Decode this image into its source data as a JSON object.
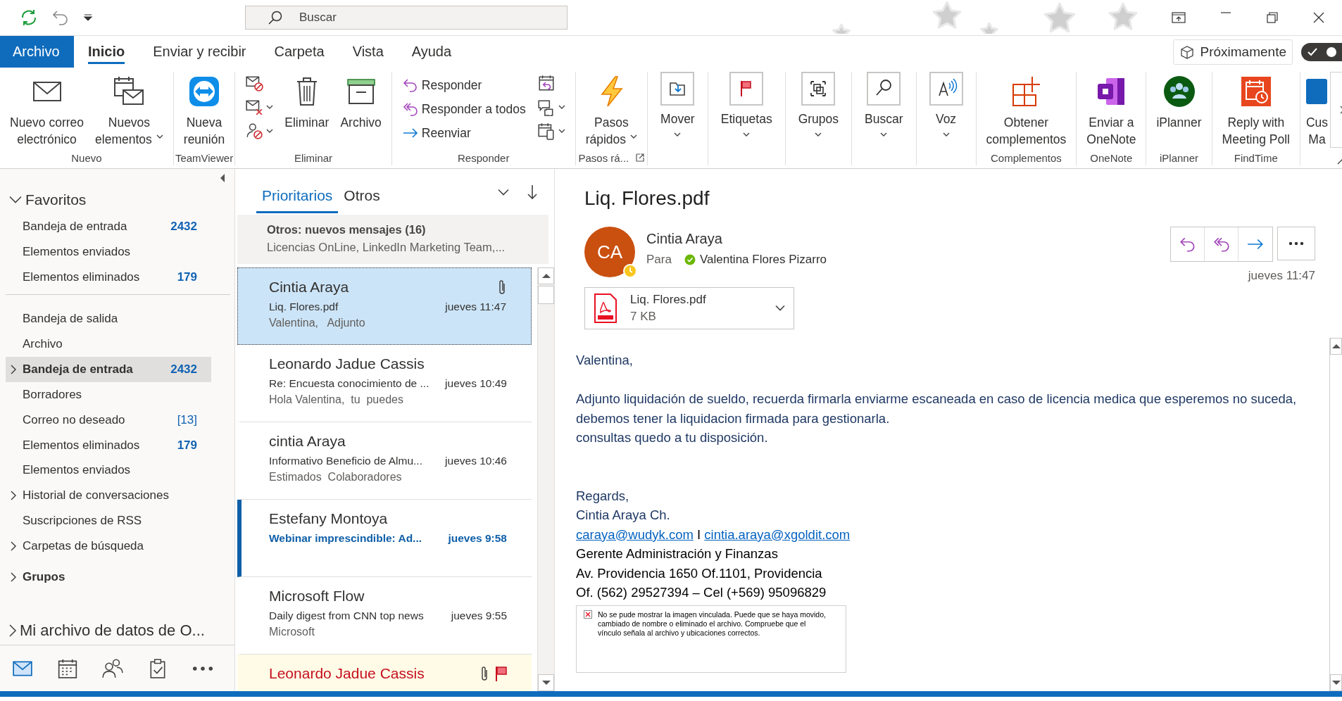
{
  "title_bar": {
    "search": {
      "placeholder": "Buscar"
    }
  },
  "ribbon_tabs": [
    {
      "label": "Archivo",
      "kind": "file",
      "selected": false
    },
    {
      "label": "Inicio",
      "kind": "tab",
      "selected": true
    },
    {
      "label": "Enviar y recibir",
      "kind": "tab",
      "selected": false
    },
    {
      "label": "Carpeta",
      "kind": "tab",
      "selected": false
    },
    {
      "label": "Vista",
      "kind": "tab",
      "selected": false
    },
    {
      "label": "Ayuda",
      "kind": "tab",
      "selected": false
    }
  ],
  "coming_soon": {
    "label": "Próximamente",
    "on": true
  },
  "ribbon_groups": [
    {
      "label": "Nuevo",
      "items": [
        {
          "kind": "large",
          "lines": [
            "Nuevo correo",
            "electrónico"
          ]
        },
        {
          "kind": "large",
          "lines": [
            "Nuevos",
            "elementos"
          ],
          "dropdown": true
        }
      ]
    },
    {
      "label": "TeamViewer",
      "items": [
        {
          "kind": "large",
          "lines": [
            "Nueva",
            "reunión"
          ]
        }
      ]
    },
    {
      "label": "Eliminar",
      "items": [
        {
          "kind": "icon-stack",
          "icons": [
            {
              "dropdown": false
            },
            {
              "dropdown": true
            },
            {
              "dropdown": true
            }
          ]
        },
        {
          "kind": "large",
          "lines": [
            "Eliminar"
          ]
        },
        {
          "kind": "large",
          "lines": [
            "Archivo"
          ]
        }
      ]
    },
    {
      "label": "Responder",
      "items": [
        {
          "kind": "small-stack",
          "entries": [
            {
              "label": "Responder"
            },
            {
              "label": "Responder a todos"
            },
            {
              "label": "Reenviar"
            }
          ]
        },
        {
          "kind": "icon-stack",
          "icons": [
            {
              "dropdown": false
            },
            {
              "dropdown": true
            },
            {
              "dropdown": true
            }
          ]
        }
      ]
    },
    {
      "label": "Pasos rá...",
      "launcher": true,
      "items": [
        {
          "kind": "large",
          "lines": [
            "Pasos",
            "rápidos"
          ],
          "dropdown": true
        }
      ]
    },
    {
      "items": [
        {
          "kind": "boxed",
          "label": "Mover",
          "dropdown": true
        }
      ]
    },
    {
      "items": [
        {
          "kind": "boxed",
          "label": "Etiquetas",
          "dropdown": true
        }
      ]
    },
    {
      "items": [
        {
          "kind": "boxed",
          "label": "Grupos",
          "dropdown": true
        }
      ]
    },
    {
      "items": [
        {
          "kind": "boxed",
          "label": "Buscar",
          "dropdown": true
        }
      ]
    },
    {
      "items": [
        {
          "kind": "boxed",
          "label": "Voz",
          "dropdown": true
        }
      ]
    },
    {
      "label": "Complementos",
      "items": [
        {
          "kind": "large",
          "lines": [
            "Obtener",
            "complementos"
          ]
        }
      ]
    },
    {
      "label": "OneNote",
      "items": [
        {
          "kind": "large",
          "lines": [
            "Enviar a",
            "OneNote"
          ]
        }
      ]
    },
    {
      "label": "iPlanner",
      "items": [
        {
          "kind": "large",
          "lines": [
            "iPlanner"
          ]
        }
      ]
    },
    {
      "label": "FindTime",
      "items": [
        {
          "kind": "large",
          "lines": [
            "Reply with",
            "Meeting Poll"
          ]
        }
      ]
    },
    {
      "items": [
        {
          "kind": "large",
          "lines": [
            "Cus",
            "Ma"
          ]
        }
      ]
    }
  ],
  "navigation": {
    "favorites": {
      "label": "Favoritos",
      "expanded": true,
      "items": [
        {
          "label": "Bandeja de entrada",
          "count": "2432",
          "count_total": false,
          "selected": false
        },
        {
          "label": "Elementos enviados",
          "selected": false
        },
        {
          "label": "Elementos eliminados",
          "count": "179",
          "count_total": false,
          "selected": false
        }
      ]
    },
    "folders": [
      {
        "label": "Bandeja de salida",
        "expandable": false,
        "selected": false
      },
      {
        "label": "Archivo",
        "expandable": false,
        "selected": false
      },
      {
        "label": "Bandeja de entrada",
        "count": "2432",
        "count_total": false,
        "expandable": true,
        "selected": true
      },
      {
        "label": "Borradores",
        "expandable": false,
        "selected": false
      },
      {
        "label": "Correo no deseado",
        "count": "[13]",
        "count_total": true,
        "expandable": false,
        "selected": false
      },
      {
        "label": "Elementos eliminados",
        "count": "179",
        "count_total": false,
        "expandable": false,
        "selected": false
      },
      {
        "label": "Elementos enviados",
        "expandable": false,
        "selected": false
      },
      {
        "label": "Historial de conversaciones",
        "expandable": true,
        "selected": false
      },
      {
        "label": "Suscripciones de RSS",
        "expandable": false,
        "selected": false
      },
      {
        "label": "Carpetas de búsqueda",
        "expandable": true,
        "selected": false
      }
    ],
    "groups": {
      "label": "Grupos",
      "expanded": false
    },
    "data_file": {
      "label": "Mi archivo de datos de O...",
      "expanded": false
    },
    "modules": [
      {
        "kind": "mail",
        "selected": true
      },
      {
        "kind": "calendar",
        "selected": false
      },
      {
        "kind": "people",
        "selected": false
      },
      {
        "kind": "tasks",
        "selected": false
      },
      {
        "kind": "more",
        "selected": false
      }
    ]
  },
  "message_list": {
    "tabs": [
      {
        "label": "Prioritarios",
        "selected": true
      },
      {
        "label": "Otros",
        "selected": false
      }
    ],
    "other_banner": {
      "title": "Otros: nuevos mensajes (16)",
      "senders": "Licencias OnLine, LinkedIn Marketing Team,..."
    },
    "messages": [
      {
        "sender": "Cintia Araya",
        "subject": "Liq. Flores.pdf",
        "time": "jueves 11:47",
        "preview": "Valentina,   Adjunto",
        "selected": true,
        "unread": false,
        "flagged": false,
        "attachment": true
      },
      {
        "sender": "Leonardo Jadue Cassis",
        "subject": "Re: Encuesta conocimiento de ...",
        "time": "jueves 10:49",
        "preview": "Hola Valentina,  tu  puedes",
        "selected": false,
        "unread": false,
        "flagged": false,
        "attachment": false
      },
      {
        "sender": "cintia Araya",
        "subject": "Informativo Beneficio de Almu...",
        "time": "jueves 10:46",
        "preview": "Estimados  Colaboradores",
        "selected": false,
        "unread": false,
        "flagged": false,
        "attachment": false
      },
      {
        "sender": "Estefany Montoya",
        "subject": "Webinar imprescindible: Ad...",
        "time": "jueves 9:58",
        "selected": false,
        "unread": true,
        "flagged": false,
        "attachment": false
      },
      {
        "sender": "Microsoft Flow",
        "subject": "Daily digest from CNN top news",
        "time": "jueves 9:55",
        "preview": "Microsoft",
        "selected": false,
        "unread": false,
        "flagged": false,
        "attachment": false
      },
      {
        "sender": "Leonardo Jadue Cassis",
        "selected": false,
        "unread": false,
        "flagged": true,
        "attachment": true
      }
    ]
  },
  "reading_pane": {
    "subject": "Liq. Flores.pdf",
    "sender": {
      "initials": "CA",
      "name": "Cintia Araya"
    },
    "to_label": "Para",
    "recipient": "Valentina Flores Pizarro",
    "time": "jueves 11:47",
    "attachment": {
      "name": "Liq. Flores.pdf",
      "size": "7 KB"
    },
    "body": [
      {
        "kind": "text",
        "text": "Valentina,"
      },
      {
        "kind": "blank"
      },
      {
        "kind": "text",
        "text": "Adjunto liquidación de sueldo, recuerda firmarla enviarme escaneada en caso de licencia medica que esperemos no suceda, debemos tener la liquidacion firmada para gestionarla."
      },
      {
        "kind": "text",
        "text": "consultas quedo a tu disposición."
      },
      {
        "kind": "blank"
      },
      {
        "kind": "blank"
      },
      {
        "kind": "text",
        "text": "Regards,"
      },
      {
        "kind": "text",
        "text": "Cintia Araya Ch."
      },
      {
        "kind": "links",
        "links": [
          "caraya@wudyk.com",
          "cintia.araya@xgoldit.com"
        ],
        "separator": "I"
      },
      {
        "kind": "signature",
        "text": "Gerente Administración y Finanzas"
      },
      {
        "kind": "signature",
        "text": "Av. Providencia 1650 Of.1101, Providencia"
      },
      {
        "kind": "signature",
        "text": "Of. (562) 29527394 – Cel (+569) 95096829"
      },
      {
        "kind": "broken_image",
        "message": "No se pude mostrar la imagen vinculada. Puede que se haya movido, cambiado de nombre o eliminado el archivo. Compruebe que el vínculo señala al archivo y ubicaciones correctos."
      }
    ]
  }
}
